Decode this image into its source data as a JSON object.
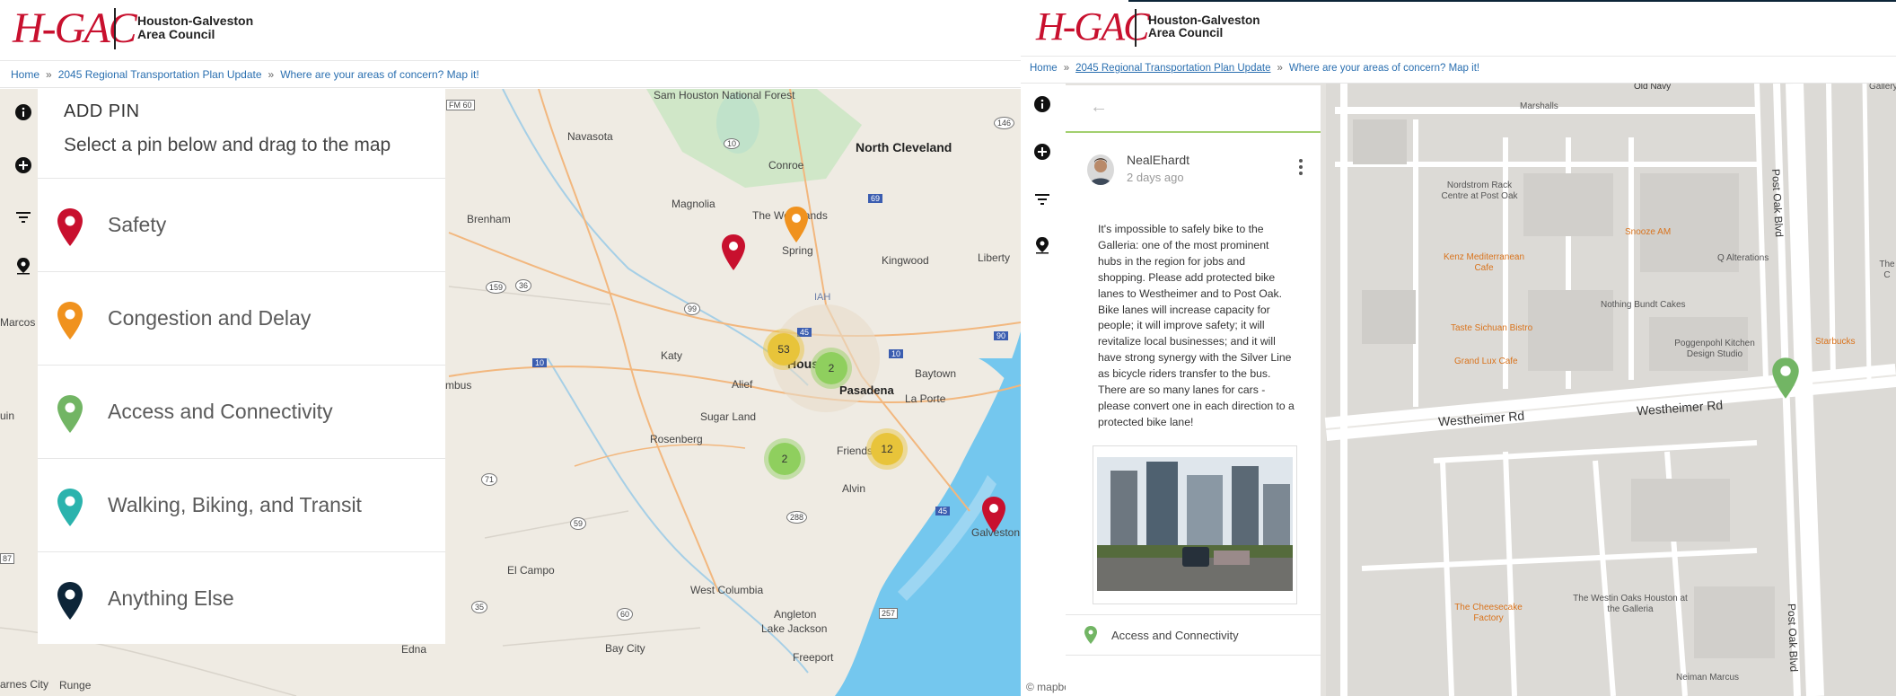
{
  "org": {
    "logo_mark": "H-GAC",
    "name_line1": "Houston-Galveston",
    "name_line2": "Area Council"
  },
  "breadcrumb": {
    "home": "Home",
    "sep": "»",
    "plan": "2045 Regional Transportation Plan Update",
    "current": "Where are your areas of concern? Map it!"
  },
  "rail_icons": [
    "info-icon",
    "add-icon",
    "filter-icon",
    "location-pin-icon"
  ],
  "add_pin": {
    "title": "ADD PIN",
    "subtitle": "Select a pin below and drag to the map",
    "categories": [
      {
        "label": "Safety",
        "color": "#c8102e"
      },
      {
        "label": "Congestion and Delay",
        "color": "#f0921e"
      },
      {
        "label": "Access and Connectivity",
        "color": "#72b564"
      },
      {
        "label": "Walking, Biking, and Transit",
        "color": "#2bb3ad"
      },
      {
        "label": "Anything Else",
        "color": "#0d2538"
      }
    ]
  },
  "left_map": {
    "places": [
      "Sam Houston National Forest",
      "Navasota",
      "Conroe",
      "North Cleveland",
      "Magnolia",
      "The Woodlands",
      "Spring",
      "Kingwood",
      "Liberty",
      "Brenham",
      "IAH",
      "Katy",
      "Houston",
      "Baytown",
      "Alief",
      "Pasadena",
      "La Porte",
      "Sugar Land",
      "Rosenberg",
      "Friendswood",
      "Alvin",
      "Galveston",
      "El Campo",
      "West Columbia",
      "Angleton",
      "Lake Jackson",
      "Freeport",
      "Bay City",
      "Edna",
      "Marcos",
      "uin",
      "mbus",
      "arnes City",
      "Runge"
    ],
    "highways": [
      "FM 60",
      "10",
      "146",
      "45",
      "69",
      "159",
      "36",
      "99",
      "10",
      "10",
      "90",
      "71",
      "59",
      "288",
      "45",
      "87",
      "60",
      "35",
      "257"
    ],
    "clusters": [
      {
        "count": "53",
        "color": "#e8c43a"
      },
      {
        "count": "2",
        "color": "#8fcf5e"
      },
      {
        "count": "12",
        "color": "#e8c43a"
      },
      {
        "count": "2",
        "color": "#8fcf5e"
      }
    ]
  },
  "comment": {
    "back": "←",
    "username": "NealEhardt",
    "age": "2 days ago",
    "body": "It's impossible to safely bike to the Galleria: one of the most prominent hubs in the region for jobs and shopping. Please add protected bike lanes to Westheimer and to Post Oak. Bike lanes will increase capacity for people; it will improve safety; it will revitalize local businesses; and it will have strong synergy with the Silver Line as bicycle riders transfer to the bus. There are so many lanes for cars - please convert one in each direction to a protected bike lane!",
    "category": "Access and Connectivity"
  },
  "right_map": {
    "streets": [
      "Westheimer Rd",
      "Westheimer Rd",
      "Post Oak Blvd",
      "Post Oak Blvd",
      "Old Navy"
    ],
    "pois": [
      {
        "label": "Marshalls",
        "orange": false
      },
      {
        "label": "Nordstrom Rack Centre at Post Oak",
        "orange": false
      },
      {
        "label": "Snooze AM",
        "orange": true
      },
      {
        "label": "Q Alterations",
        "orange": false
      },
      {
        "label": "Kenz Mediterranean Cafe",
        "orange": true
      },
      {
        "label": "Nothing Bundt Cakes",
        "orange": false
      },
      {
        "label": "Taste Sichuan Bistro",
        "orange": true
      },
      {
        "label": "Poggenpohl Kitchen Design Studio",
        "orange": false
      },
      {
        "label": "Starbucks",
        "orange": true
      },
      {
        "label": "Grand Lux Cafe",
        "orange": true
      },
      {
        "label": "The Cheesecake Factory",
        "orange": true
      },
      {
        "label": "The Westin Oaks Houston at the Galleria",
        "orange": false
      },
      {
        "label": "Neiman Marcus",
        "orange": false
      },
      {
        "label": "Gallery",
        "orange": false
      },
      {
        "label": "The C",
        "orange": false
      }
    ],
    "attribution": "© mapbox"
  }
}
